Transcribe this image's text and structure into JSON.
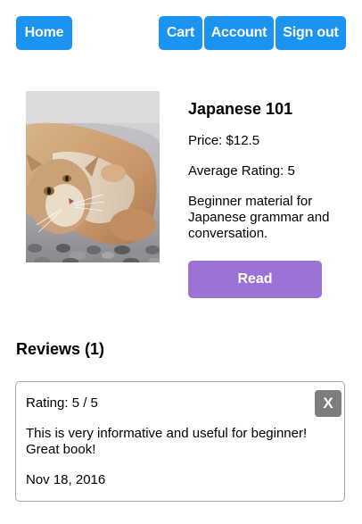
{
  "nav": {
    "home": "Home",
    "cart": "Cart",
    "account": "Account",
    "sign_out": "Sign out",
    "button_color": "#1a93f1"
  },
  "book": {
    "title": "Japanese 101",
    "price": "Price: $12.5",
    "average_rating": "Average Rating: 5",
    "description": "Beginner material for Japanese grammar and conversation.",
    "read_label": "Read",
    "read_button_color": "#9b73d6",
    "cover_alt": "Photo of a cat lying on its back on pebbles"
  },
  "reviews": {
    "heading": "Reviews (1)",
    "items": [
      {
        "rating": "Rating: 5 / 5",
        "text": "This is very informative and useful for beginner! Great book!",
        "date": "Nov 18, 2016",
        "delete_label": "X"
      }
    ]
  }
}
